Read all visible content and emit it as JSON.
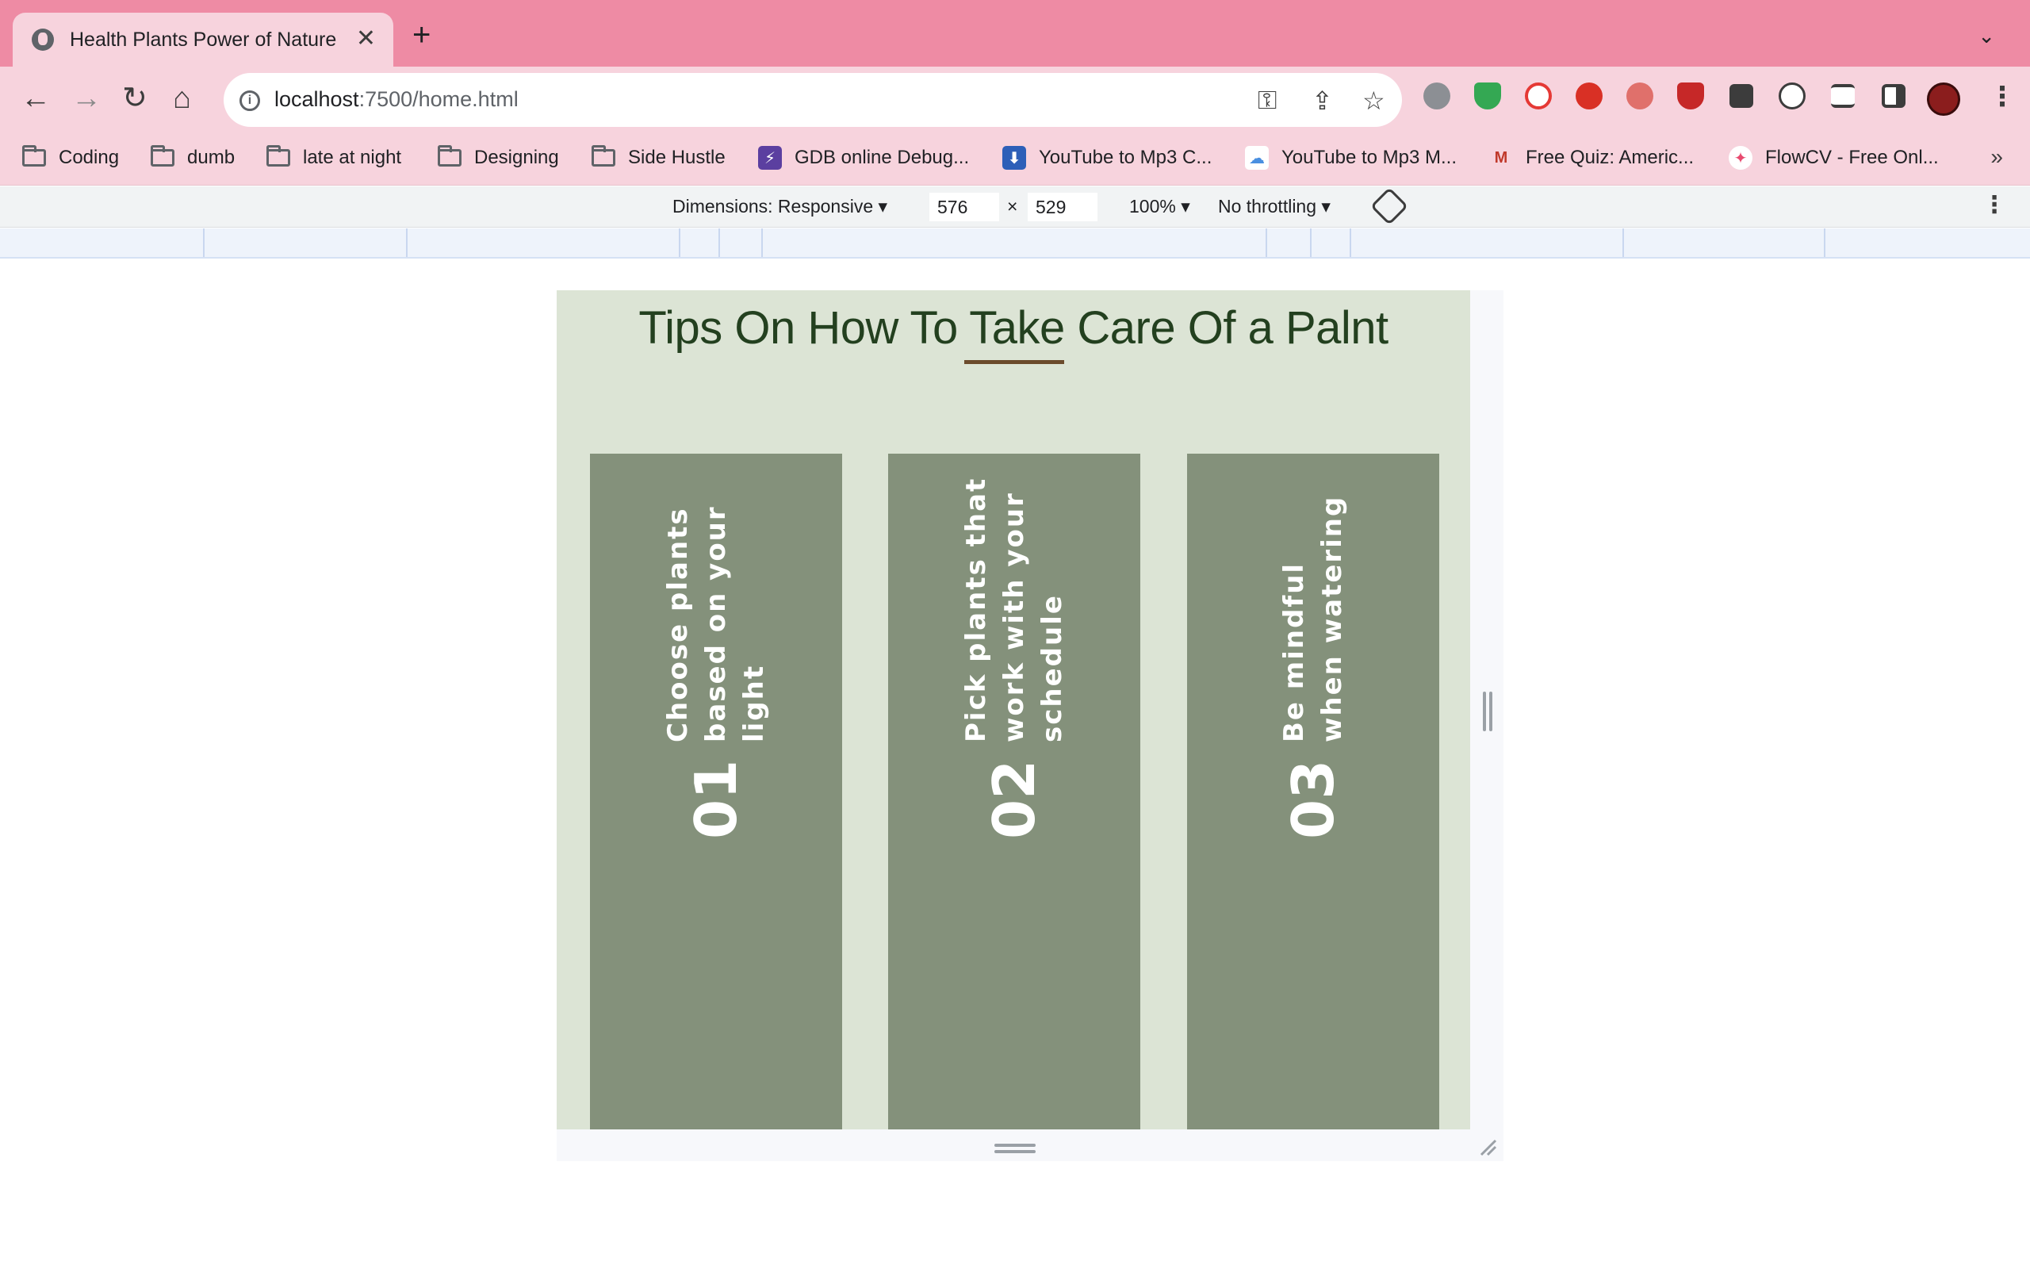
{
  "browser": {
    "tab": {
      "title": "Health Plants Power of Nature",
      "close": "✕"
    },
    "new_tab": "+",
    "tab_menu": "⌄",
    "nav": {
      "back": "←",
      "forward": "→",
      "reload": "↻",
      "home": "⌂"
    },
    "address": {
      "host": "localhost",
      "rest": ":7500/home.html"
    },
    "omni_icons": {
      "key": "⚿",
      "share": "⇪",
      "star": "☆"
    },
    "kebab": "⋮",
    "bookmarks": [
      {
        "label": "Coding",
        "icon": "folder-icon"
      },
      {
        "label": "dumb",
        "icon": "folder-icon"
      },
      {
        "label": "late at night",
        "icon": "folder-icon"
      },
      {
        "label": "Designing",
        "icon": "folder-icon"
      },
      {
        "label": "Side Hustle",
        "icon": "folder-icon"
      },
      {
        "label": "GDB online Debug...",
        "icon": "gdb-icon",
        "glyph": "⚡",
        "color": "#5b3fa0"
      },
      {
        "label": "YouTube to Mp3 C...",
        "icon": "download-icon",
        "glyph": "⬇",
        "color": "#2d5fb8"
      },
      {
        "label": "YouTube to Mp3 M...",
        "icon": "cloud-icon",
        "glyph": "☁",
        "color": "#4a8fe0"
      },
      {
        "label": "Free Quiz: Americ...",
        "icon": "quiz-icon",
        "glyph": "M",
        "color": "#c0392b"
      },
      {
        "label": "FlowCV - Free Onl...",
        "icon": "flowcv-icon",
        "glyph": "✦",
        "color": "#e84a6f"
      }
    ],
    "bookmarks_more": "»"
  },
  "devtools": {
    "dimensions_label": "Dimensions: Responsive ▾",
    "width": "576",
    "times": "×",
    "height": "529",
    "zoom": "100% ▾",
    "throttling": "No throttling ▾",
    "kebab": "⋮"
  },
  "page": {
    "title": "Tips On How To Take Care Of a Palnt",
    "cards": [
      {
        "number": "01",
        "text": "Choose plants based on your light"
      },
      {
        "number": "02",
        "text": "Pick plants that work with your schedule"
      },
      {
        "number": "03",
        "text": "Be mindful when watering"
      }
    ]
  },
  "colors": {
    "tab_strip": "#ee8ba4",
    "toolbar": "#f7d3dd",
    "page_background": "#dce4d5",
    "card": "#84917b",
    "title": "#23401f",
    "underline": "#6b4b2c"
  }
}
